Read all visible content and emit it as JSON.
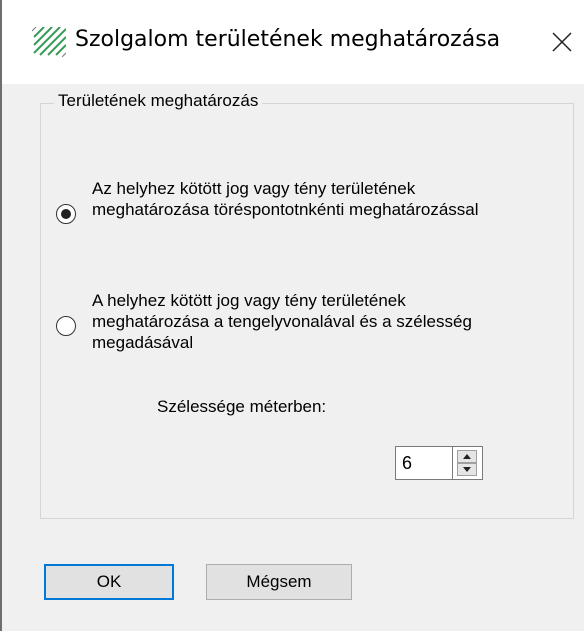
{
  "window": {
    "title": "Szolgalom területének meghatározása",
    "icon": "pattern-hatch-icon",
    "close_icon": "close-icon"
  },
  "group": {
    "label": "Területének meghatározás"
  },
  "options": [
    {
      "label": "Az helyhez kötött jog vagy tény területének meghatározása töréspontotnkénti meghatározással",
      "selected": true
    },
    {
      "label": "A helyhez kötött jog vagy tény területének meghatározása a tengelyvonalával és a szélesség megadásával",
      "selected": false
    }
  ],
  "width_field": {
    "label": "Szélessége méterben:",
    "value": "6"
  },
  "buttons": {
    "ok": "OK",
    "cancel": "Mégsem"
  },
  "colors": {
    "accent": "#0078d7",
    "dialog_bg": "#f0f0f0",
    "titlebar_bg": "#ffffff"
  }
}
